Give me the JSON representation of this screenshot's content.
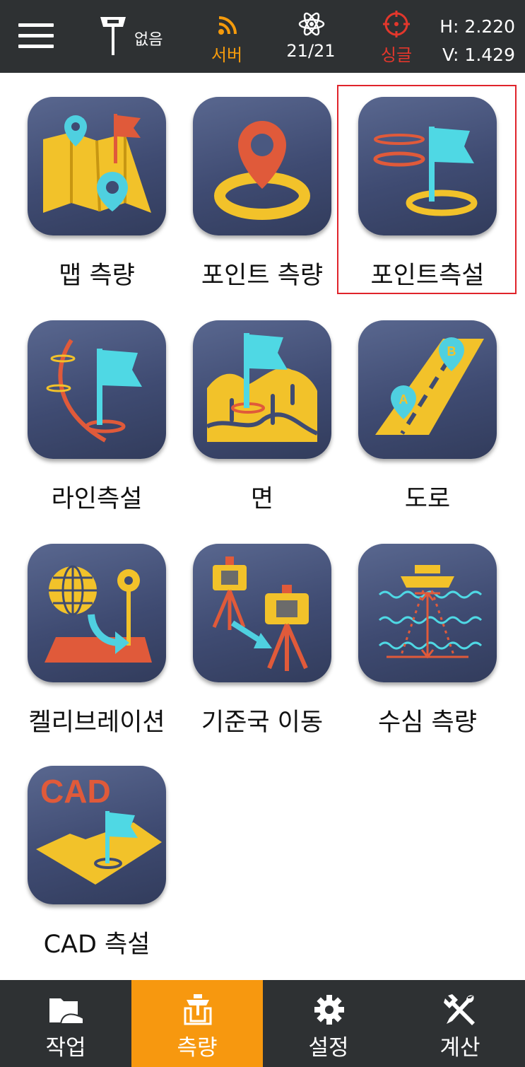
{
  "status_bar": {
    "receiver_text": "없음",
    "server_label": "서버",
    "satellites": "21/21",
    "solution_label": "싱글",
    "h_value": "H: 2.220",
    "v_value": "V: 1.429"
  },
  "tiles": [
    {
      "label": "맵 측량",
      "icon": "map-survey-icon"
    },
    {
      "label": "포인트 측량",
      "icon": "point-survey-icon"
    },
    {
      "label": "포인트측설",
      "icon": "point-stakeout-icon"
    },
    {
      "label": "라인측설",
      "icon": "line-stakeout-icon"
    },
    {
      "label": "면",
      "icon": "surface-icon"
    },
    {
      "label": "도로",
      "icon": "road-icon"
    },
    {
      "label": "켈리브레이션",
      "icon": "calibration-icon"
    },
    {
      "label": "기준국 이동",
      "icon": "base-shift-icon"
    },
    {
      "label": "수심 측량",
      "icon": "depth-survey-icon"
    },
    {
      "label": "CAD 측설",
      "icon": "cad-stakeout-icon",
      "icon_text": "CAD"
    }
  ],
  "bottom_nav": [
    {
      "label": "작업",
      "icon": "folder-icon",
      "active": false
    },
    {
      "label": "측량",
      "icon": "survey-icon",
      "active": true
    },
    {
      "label": "설정",
      "icon": "gear-icon",
      "active": false
    },
    {
      "label": "계산",
      "icon": "tools-icon",
      "active": false
    }
  ],
  "colors": {
    "topbar": "#2e3133",
    "accent_orange": "#f7980f",
    "fix_red": "#e3372c",
    "highlight_red": "#e0242b"
  }
}
